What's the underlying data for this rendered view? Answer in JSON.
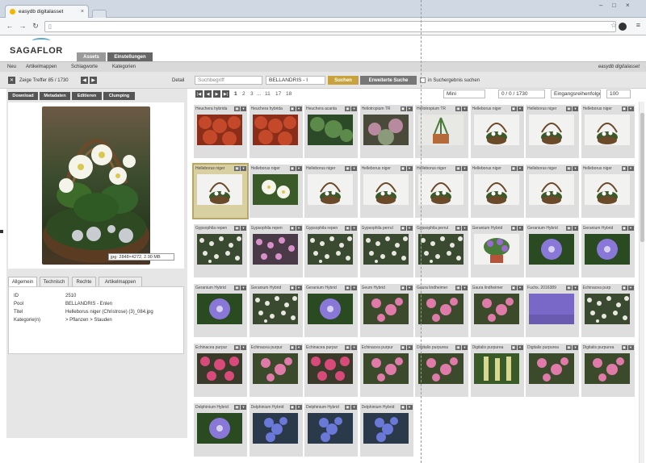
{
  "browser": {
    "tab_title": "easydb digitalasset",
    "url": "",
    "window_controls": [
      "–",
      "□",
      "×"
    ]
  },
  "app": {
    "logo_text": "SAGAFLOR",
    "main_tabs": [
      "Assets",
      "Einstellungen"
    ],
    "brand": "easydb digitalasset",
    "subnav": [
      "Neu",
      "Artikelmappen",
      "Schlagworte",
      "Kategorien"
    ]
  },
  "toolbar": {
    "hits": "Zeige Treffer 85 / 1730",
    "detail": "Detail",
    "search_placeholder": "Suchbegriff",
    "collection": "BELLANDRIS - I",
    "search_button": "Suchen",
    "advanced_button": "Erweiterte Suche",
    "in_results": "in Suchergebnis suchen"
  },
  "actions": [
    "Download",
    "Metadaten",
    "Editieren",
    "Clumping"
  ],
  "preview": {
    "info": "jpg: 2848×4272, 2.90 MB"
  },
  "detail_tabs": [
    "Allgemein",
    "Technisch",
    "Rechte",
    "Artikelmappen"
  ],
  "details": [
    {
      "label": "ID",
      "value": "2510"
    },
    {
      "label": "Pool",
      "value": "BELLANDRIS - Enlen"
    },
    {
      "label": "Titel",
      "value": "Helleborus niger (Christrose) (3)_084.jpg"
    },
    {
      "label": "Kategorie(n)",
      "value": "> Pflanzen > Stauden"
    }
  ],
  "grid_toolbar": {
    "pages": [
      "1",
      "2",
      "3",
      "...",
      "11",
      "17",
      "18"
    ],
    "sort": "Mini",
    "count": "0 / 0 / 1730",
    "sort_field": "Eingangsreihenfolge",
    "per_page": "100"
  },
  "tiles": [
    {
      "caption": "Heuchera hybrida",
      "img": "red"
    },
    {
      "caption": "Heuchera hybrida",
      "img": "red"
    },
    {
      "caption": "Heuchera acanta",
      "img": "green"
    },
    {
      "caption": "Heliotropium TR",
      "img": "mixed"
    },
    {
      "caption": "Heliotropium TR",
      "img": "pot"
    },
    {
      "caption": "Helleborus niger",
      "img": "basket"
    },
    {
      "caption": "Helleborus niger",
      "img": "basket"
    },
    {
      "caption": "Helleborus niger",
      "img": "basket"
    },
    {
      "caption": "Helleborus niger",
      "img": "basket",
      "selected": true
    },
    {
      "caption": "Helleborus niger",
      "img": "whiteflower"
    },
    {
      "caption": "Helleborus niger",
      "img": "basket"
    },
    {
      "caption": "Helleborus niger",
      "img": "basket"
    },
    {
      "caption": "Helleborus niger",
      "img": "basket"
    },
    {
      "caption": "Helleborus niger",
      "img": "basket"
    },
    {
      "caption": "Helleborus niger",
      "img": "basket"
    },
    {
      "caption": "Helleborus niger",
      "img": "basket"
    },
    {
      "caption": "Gypsophila repen",
      "img": "whitefield"
    },
    {
      "caption": "Gypsophila repen",
      "img": "pinkfield"
    },
    {
      "caption": "Gypsophila repen",
      "img": "whitefield"
    },
    {
      "caption": "Gypsophila perrul",
      "img": "whitefield"
    },
    {
      "caption": "Gypsophila perrul",
      "img": "whitefield"
    },
    {
      "caption": "Geranium Hybrid",
      "img": "purplepot"
    },
    {
      "caption": "Geranium Hybrid",
      "img": "purple"
    },
    {
      "caption": "Geranium Hybrid",
      "img": "purple"
    },
    {
      "caption": "Geranium Hybrid",
      "img": "purple"
    },
    {
      "caption": "Geranium Hybrid",
      "img": "whitefield"
    },
    {
      "caption": "Geranium Hybrid",
      "img": "purple"
    },
    {
      "caption": "Geum Hybrid",
      "img": "pink"
    },
    {
      "caption": "Gaura lindheimer",
      "img": "pink"
    },
    {
      "caption": "Gaura lindheimer",
      "img": "pink"
    },
    {
      "caption": "Fuchs. 2016389",
      "img": "lavender"
    },
    {
      "caption": "Echinacea purp",
      "img": "whitefield"
    },
    {
      "caption": "Echinacea purpur",
      "img": "pinkred"
    },
    {
      "caption": "Echinacea purpur",
      "img": "pink"
    },
    {
      "caption": "Echinacea purpur",
      "img": "pinkred"
    },
    {
      "caption": "Echinacea purpur",
      "img": "pink"
    },
    {
      "caption": "Digitalis purpurea",
      "img": "pink"
    },
    {
      "caption": "Digitalis purpurea",
      "img": "yellowgreen"
    },
    {
      "caption": "Digitalis purpurea",
      "img": "pink"
    },
    {
      "caption": "Digitalis purpurea",
      "img": "pink"
    },
    {
      "caption": "Delphinium Hybrid",
      "img": "purple"
    },
    {
      "caption": "Delphinium Hybrid",
      "img": "blue"
    },
    {
      "caption": "Delphinium Hybrid",
      "img": "blue"
    },
    {
      "caption": "Delphinium Hybrid",
      "img": "blue"
    }
  ],
  "colors": {
    "accent_orange": "#c8a23c",
    "tab_active": "#8a8a8a",
    "dark_button": "#555555",
    "brand_bar": "#d9d9d9"
  }
}
